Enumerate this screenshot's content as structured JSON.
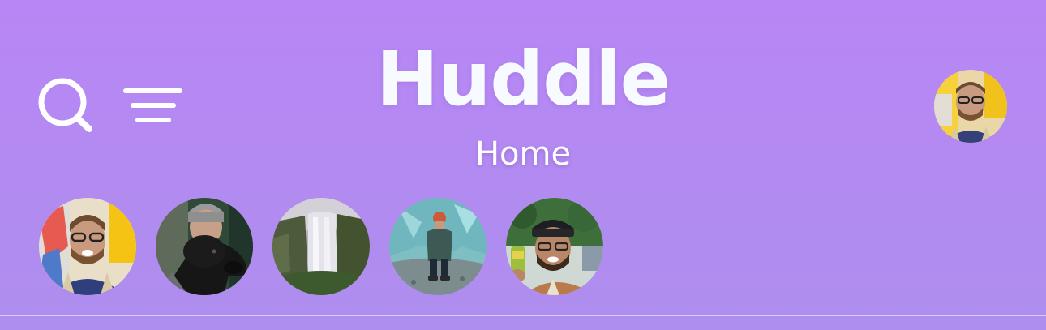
{
  "app": {
    "title": "Huddle",
    "subtitle": "Home"
  },
  "header": {
    "left_icons": [
      "search-icon",
      "filter-icon"
    ],
    "profile_avatar": "user-avatar"
  },
  "stories": [
    {
      "avatar": "story-avatar-1"
    },
    {
      "avatar": "story-avatar-2"
    },
    {
      "avatar": "story-avatar-3"
    },
    {
      "avatar": "story-avatar-4"
    },
    {
      "avatar": "story-avatar-5"
    }
  ],
  "colors": {
    "background_top": "#b886f5",
    "background_bottom": "#ae8eee",
    "title": "#f7fbff",
    "icon": "#ffffff"
  }
}
